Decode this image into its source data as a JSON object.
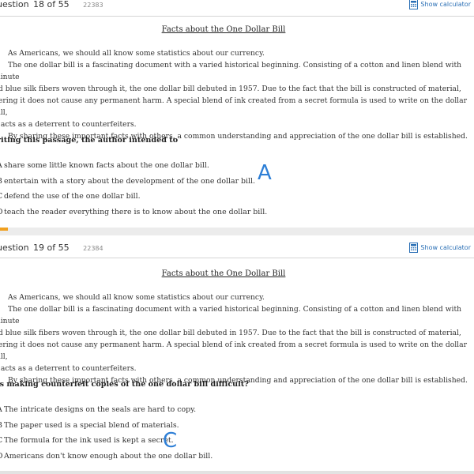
{
  "calculator_label": "Show calculator",
  "title": "Facts about the One Dollar Bill",
  "passage": [
    "As Americans, we should all know some statistics about our currency.",
    "The one dollar bill is a fascinating document with a varied historical beginning. Consisting of a cotton and linen blend with minute",
    "nd blue silk fibers woven through it, the one dollar bill debuted in 1957. Due to the fact that the bill is constructed of material,",
    "dering it does not cause any permanent harm. A special blend of ink created from a secret formula is used to write on the dollar bill,",
    "h acts as a deterrent to counterfeiters.",
    "By sharing these important facts with others, a common understanding and appreciation of the one dollar bill is established."
  ],
  "questions": [
    {
      "number_prefix": "uestion",
      "number": "18 of 55",
      "id": "22383",
      "prompt": "riting this passage, the author intended to",
      "choices": [
        {
          "letter": "A",
          "text": "share some little known facts about the one dollar bill."
        },
        {
          "letter": "B",
          "text": "entertain with a story about the development of the one dollar bill."
        },
        {
          "letter": "C",
          "text": "defend the use of the one dollar bill."
        },
        {
          "letter": "D",
          "text": "teach the reader everything there is to know about the one dollar bill."
        }
      ],
      "handwritten_answer": "A"
    },
    {
      "number_prefix": "uestion",
      "number": "19 of 55",
      "id": "22384",
      "prompt": "is making counterfeit copies of the one dollar bill difficult?",
      "choices": [
        {
          "letter": "A",
          "text": "The intricate designs on the seals are hard to copy."
        },
        {
          "letter": "B",
          "text": "The paper used is a special blend of materials."
        },
        {
          "letter": "C",
          "text": "The formula for the ink used is kept a secret."
        },
        {
          "letter": "D",
          "text": "Americans don't know enough about the one dollar bill."
        }
      ],
      "handwritten_answer": "C"
    }
  ],
  "colors": {
    "accent_link": "#2a6fb5",
    "handwritten_answer": "#2e7fd6",
    "progress_tick": "#f0a020"
  },
  "icons": {
    "calculator": "calculator-icon"
  }
}
